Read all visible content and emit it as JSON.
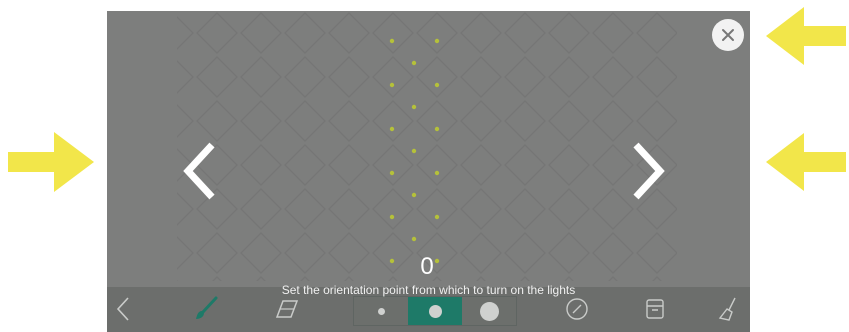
{
  "overlay": {
    "counter_value": "0",
    "instruction": "Set the orientation point from which to turn on the lights"
  },
  "icons": {
    "close": "close-icon",
    "prev": "chevron-left-icon",
    "next": "chevron-right-icon",
    "back": "back-icon",
    "brush": "brush-icon",
    "eraser": "eraser-icon",
    "size_small": "small-dot-icon",
    "size_medium": "medium-dot-icon",
    "size_large": "large-dot-icon",
    "compass": "compass-icon",
    "save": "save-icon",
    "clear": "broom-icon"
  },
  "colors": {
    "annotation_arrow": "#f2e64a",
    "panel_background": "#7d7e7d",
    "active_accent": "#1e7a68",
    "led_dot": "#b5c13a"
  },
  "toolbar": {
    "selected_size": "medium"
  }
}
